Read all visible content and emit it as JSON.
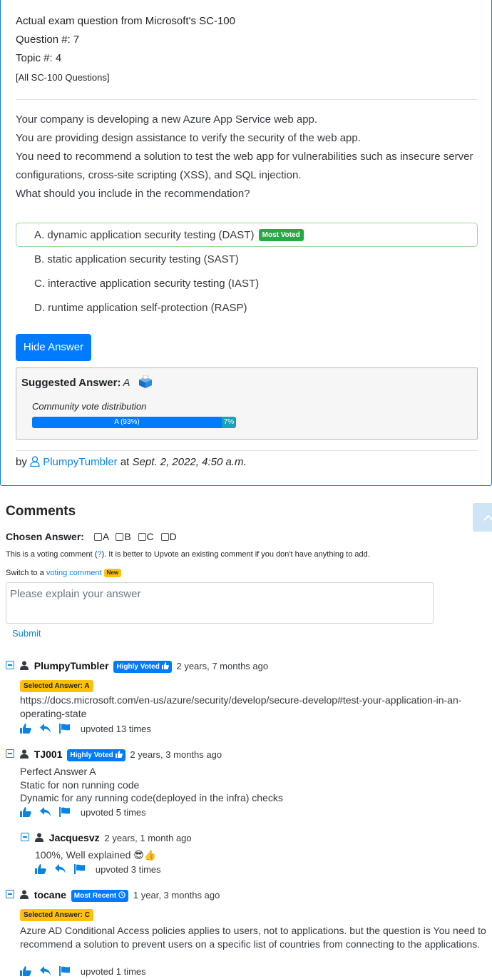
{
  "question": {
    "header": "Actual exam question from Microsoft's SC-100",
    "number_label": "Question #: 7",
    "topic_label": "Topic #: 4",
    "all_link": "[All SC-100 Questions]",
    "text_lines": [
      "Your company is developing a new Azure App Service web app.",
      "You are providing design assistance to verify the security of the web app.",
      "You need to recommend a solution to test the web app for vulnerabilities such as insecure server",
      "configurations, cross-site scripting (XSS), and SQL injection.",
      "What should you include in the recommendation?"
    ],
    "choices": [
      "A. dynamic application security testing (DAST)",
      "B. static application security testing (SAST)",
      "C. interactive application security testing (IAST)",
      "D. runtime application self-protection (RASP)"
    ],
    "most_voted_badge": "Most Voted",
    "hide_answer_label": "Hide Answer",
    "suggested_label": "Suggested Answer:",
    "suggested_value": "A",
    "vote_dist_label": "Community vote distribution",
    "vote_a_label": "A (93%)",
    "vote_a_pct": 93,
    "vote_other_label": "7%",
    "vote_other_pct": 7,
    "by_prefix": "by",
    "author": "PlumpyTumbler",
    "at_word": "at",
    "date": "Sept. 2, 2022, 4:50 a.m."
  },
  "comments_section": {
    "title": "Comments",
    "chosen_label": "Chosen Answer:",
    "options": [
      "A",
      "B",
      "C",
      "D"
    ],
    "voting_note_pre": "This is a voting comment (",
    "voting_note_q": "?",
    "voting_note_post": "). It is better to Upvote an existing comment if you don't have anything to add.",
    "switch_pre": "Switch to a",
    "switch_link": "voting comment",
    "new_badge": "New",
    "placeholder": "Please explain your answer",
    "submit_label": "Submit"
  },
  "comments": [
    {
      "user": "PlumpyTumbler",
      "badge": "Highly Voted",
      "time": "2 years, 7 months ago",
      "selected": "Selected Answer: A",
      "body": "https://docs.microsoft.com/en-us/azure/security/develop/secure-develop#test-your-application-in-an-operating-state",
      "upvotes": "upvoted 13 times"
    },
    {
      "user": "TJ001",
      "badge": "Highly Voted",
      "time": "2 years, 3 months ago",
      "body_lines": [
        "Perfect Answer A",
        "Static for non running code",
        "Dynamic for any running code(deployed in the infra) checks"
      ],
      "upvotes": "upvoted 5 times"
    },
    {
      "user": "Jacquesvz",
      "time": "2 years, 1 month ago",
      "body": "100%, Well explained 😎👍",
      "upvotes": "upvoted 3 times"
    },
    {
      "user": "tocane",
      "badge": "Most Recent",
      "time": "1 year, 3 months ago",
      "selected": "Selected Answer: C",
      "body": "Azure AD Conditional Access policies applies to users, not to applications. but the question is You need to recommend a solution to prevent users on a specific list of countries from connecting to the applications.",
      "upvotes": "upvoted 1 times"
    }
  ],
  "colors": {
    "primary": "#007bff",
    "link": "#0a84e0",
    "most_voted": "#28a745",
    "selected_badge": "#ffc107",
    "vote_other": "#17a2b8"
  }
}
